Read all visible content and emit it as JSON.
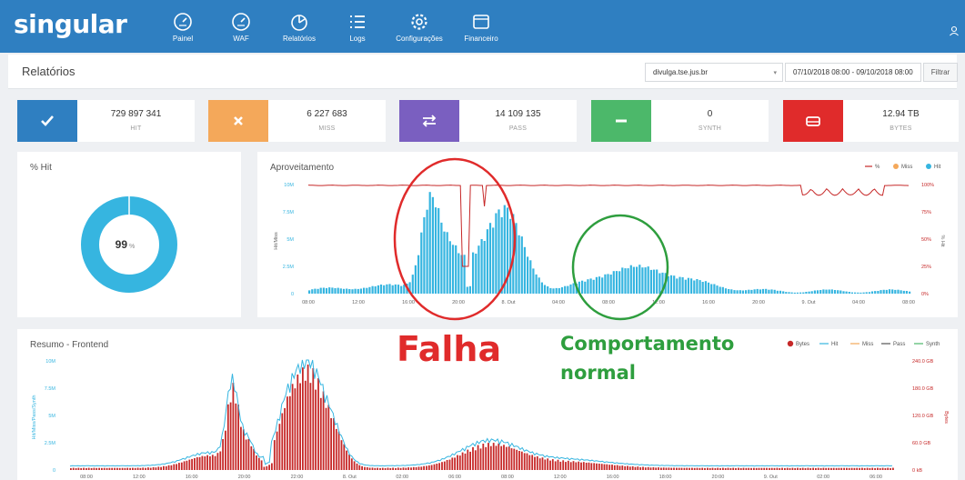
{
  "brand": {
    "logo": "singular"
  },
  "nav": [
    {
      "label": "Painel",
      "icon": "gauge-icon"
    },
    {
      "label": "WAF",
      "icon": "gauge-icon"
    },
    {
      "label": "Relatórios",
      "icon": "pie-chart-icon"
    },
    {
      "label": "Logs",
      "icon": "list-icon"
    },
    {
      "label": "Configurações",
      "icon": "gear-icon"
    },
    {
      "label": "Financeiro",
      "icon": "wallet-icon"
    }
  ],
  "page": {
    "title": "Relatórios"
  },
  "filters": {
    "domain": "divulga.tse.jus.br",
    "date_range": "07/10/2018 08:00 - 09/10/2018 08:00",
    "filter_button": "Filtrar"
  },
  "kpis": [
    {
      "value": "729 897 341",
      "label": "HIT",
      "color": "#2f7fc1",
      "icon": "check-icon"
    },
    {
      "value": "6 227 683",
      "label": "MISS",
      "color": "#f4a85a",
      "icon": "close-icon"
    },
    {
      "value": "14 109 135",
      "label": "PASS",
      "color": "#7a5fc0",
      "icon": "swap-icon"
    },
    {
      "value": "0",
      "label": "SYNTH",
      "color": "#4cb86a",
      "icon": "minus-icon"
    },
    {
      "value": "12.94 TB",
      "label": "BYTES",
      "color": "#e02b2b",
      "icon": "drive-icon"
    }
  ],
  "hit_panel": {
    "title": "% Hit",
    "value": "99",
    "unit": "%",
    "color": "#36b5e0"
  },
  "usage_panel": {
    "title": "Aproveitamento",
    "legend": [
      "%",
      "Miss",
      "Hit"
    ],
    "y_left_label": "Hit/Miss",
    "y_right_label": "% Hit",
    "y_left_ticks": [
      "10M",
      "7.5M",
      "5M",
      "2.5M",
      "0"
    ],
    "y_right_ticks": [
      "100%",
      "75%",
      "50%",
      "25%",
      "0%"
    ],
    "x_ticks": [
      "08:00",
      "12:00",
      "16:00",
      "20:00",
      "8. Out",
      "04:00",
      "08:00",
      "12:00",
      "16:00",
      "20:00",
      "9. Out",
      "04:00",
      "08:00"
    ]
  },
  "summary_panel": {
    "title": "Resumo - Frontend",
    "legend": [
      "Bytes",
      "Hit",
      "Miss",
      "Pass",
      "Synth"
    ],
    "y_left_label": "Hit/Miss/Pass/Synth",
    "y_right_label": "Bytes",
    "y_left_ticks": [
      "10M",
      "7.5M",
      "5M",
      "2.5M",
      "0"
    ],
    "y_right_ticks": [
      "240.0 GB",
      "180.0 GB",
      "120.0 GB",
      "60.0 GB",
      "0 kB"
    ],
    "x_ticks": [
      "08:00",
      "12:00",
      "16:00",
      "20:00",
      "22:00",
      "8. Out",
      "02:00",
      "06:00",
      "08:00",
      "12:00",
      "16:00",
      "18:00",
      "20:00",
      "9. Out",
      "02:00",
      "06:00"
    ]
  },
  "annotations": {
    "failure": "Falha",
    "normal": "Comportamento normal"
  },
  "colors": {
    "hit": "#36b5e0",
    "miss": "#f4a85a",
    "percent": "#c62828",
    "bytes": "#c62828",
    "pass": "#555555",
    "synth": "#4cb86a",
    "failure": "#e02b2b",
    "normal": "#2e9e3e"
  }
}
